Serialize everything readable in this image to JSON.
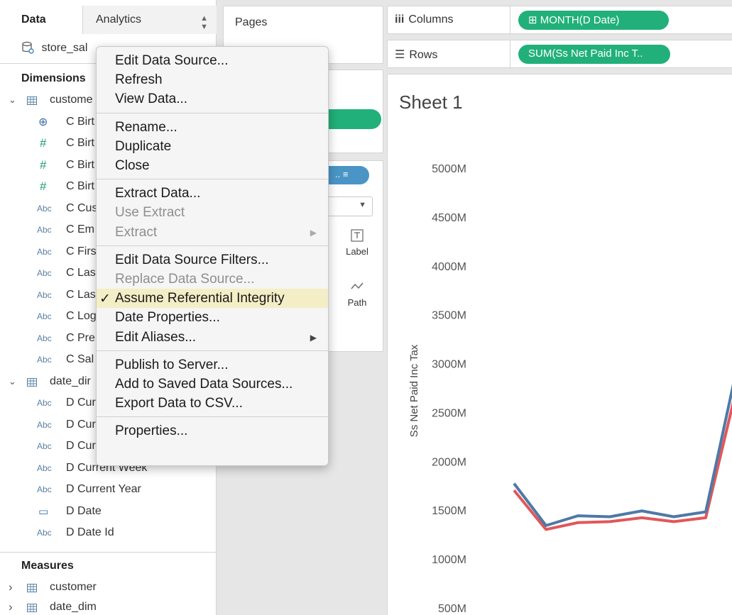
{
  "data_pane": {
    "tab_data": "Data",
    "tab_analytics": "Analytics",
    "source_name": "store_sal",
    "dimensions_title": "Dimensions",
    "measures_title": "Measures",
    "tables": [
      {
        "name": "custome",
        "fields": [
          {
            "type": "globe",
            "name": "C Birt"
          },
          {
            "type": "hash",
            "name": "C Birt"
          },
          {
            "type": "hash",
            "name": "C Birt"
          },
          {
            "type": "hash",
            "name": "C Birt"
          },
          {
            "type": "Abc",
            "name": "C Cus"
          },
          {
            "type": "Abc",
            "name": "C Em"
          },
          {
            "type": "Abc",
            "name": "C Firs"
          },
          {
            "type": "Abc",
            "name": "C Las"
          },
          {
            "type": "Abc",
            "name": "C Las"
          },
          {
            "type": "Abc",
            "name": "C Log"
          },
          {
            "type": "Abc",
            "name": "C Pre"
          },
          {
            "type": "Abc",
            "name": "C Sal"
          }
        ]
      },
      {
        "name": "date_dir",
        "fields": [
          {
            "type": "Abc",
            "name": "D Cur"
          },
          {
            "type": "Abc",
            "name": "D Cur"
          },
          {
            "type": "Abc",
            "name": "D Cur"
          },
          {
            "type": "Abc",
            "name": "D Current Week"
          },
          {
            "type": "Abc",
            "name": "D Current Year"
          },
          {
            "type": "cal",
            "name": "D Date"
          },
          {
            "type": "Abc",
            "name": "D Date Id"
          }
        ]
      }
    ],
    "measures": [
      "customer",
      "date_dim"
    ]
  },
  "mid_pane": {
    "pages_label": "Pages",
    "marks": [
      {
        "label": "Label",
        "icon": "text-label-icon"
      },
      {
        "label": "Path",
        "icon": "path-icon"
      }
    ]
  },
  "shelves": {
    "columns_label": "Columns",
    "columns_pill": "⊞ MONTH(D Date)",
    "rows_label": "Rows",
    "rows_pill": "SUM(Ss Net Paid Inc T.."
  },
  "sheet": {
    "title": "Sheet 1"
  },
  "context_menu": {
    "groups": [
      [
        {
          "label": "Edit Data Source...",
          "enabled": true
        },
        {
          "label": "Refresh",
          "enabled": true
        },
        {
          "label": "View Data...",
          "enabled": true
        }
      ],
      [
        {
          "label": "Rename...",
          "enabled": true
        },
        {
          "label": "Duplicate",
          "enabled": true
        },
        {
          "label": "Close",
          "enabled": true
        }
      ],
      [
        {
          "label": "Extract Data...",
          "enabled": true
        },
        {
          "label": "Use Extract",
          "enabled": false
        },
        {
          "label": "Extract",
          "enabled": false,
          "submenu": true
        }
      ],
      [
        {
          "label": "Edit Data Source Filters...",
          "enabled": true
        },
        {
          "label": "Replace Data Source...",
          "enabled": false
        },
        {
          "label": "Assume Referential Integrity",
          "enabled": true,
          "checked": true
        },
        {
          "label": "Date Properties...",
          "enabled": true
        },
        {
          "label": "Edit Aliases...",
          "enabled": true,
          "submenu": true
        }
      ],
      [
        {
          "label": "Publish to Server...",
          "enabled": true
        },
        {
          "label": "Add to Saved Data Sources...",
          "enabled": true
        },
        {
          "label": "Export Data to CSV...",
          "enabled": true
        }
      ],
      [
        {
          "label": "Properties...",
          "enabled": true
        }
      ]
    ]
  },
  "chart_data": {
    "type": "line",
    "title": "",
    "ylabel": "Ss Net Paid Inc Tax",
    "yticks": [
      "500M",
      "1000M",
      "1500M",
      "2000M",
      "2500M",
      "3000M",
      "3500M",
      "4000M",
      "4500M",
      "5000M"
    ],
    "ylim": [
      500,
      5000
    ],
    "x": [
      1,
      2,
      3,
      4,
      5,
      6,
      7,
      8
    ],
    "series": [
      {
        "color": "#4e79a7",
        "values": [
          1780,
          1350,
          1450,
          1440,
          1500,
          1440,
          1490,
          3000
        ]
      },
      {
        "color": "#e15759",
        "values": [
          1710,
          1310,
          1380,
          1390,
          1430,
          1390,
          1430,
          2800
        ]
      }
    ],
    "grid": false
  }
}
